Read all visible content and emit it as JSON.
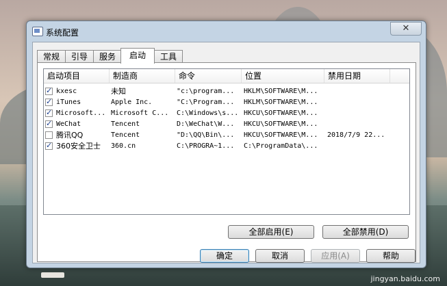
{
  "window": {
    "title": "系统配置",
    "close_glyph": "✕"
  },
  "tabs": [
    {
      "label": "常规"
    },
    {
      "label": "引导"
    },
    {
      "label": "服务"
    },
    {
      "label": "启动"
    },
    {
      "label": "工具"
    }
  ],
  "active_tab": "启动",
  "columns": [
    "启动项目",
    "制造商",
    "命令",
    "位置",
    "禁用日期"
  ],
  "rows": [
    {
      "checked": true,
      "name": "kxesc",
      "maker": "未知",
      "command": "\"c:\\program...",
      "location": "HKLM\\SOFTWARE\\M...",
      "disabled_date": ""
    },
    {
      "checked": true,
      "name": "iTunes",
      "maker": "Apple Inc.",
      "command": "\"C:\\Program...",
      "location": "HKLM\\SOFTWARE\\M...",
      "disabled_date": ""
    },
    {
      "checked": true,
      "name": "Microsoft...",
      "maker": "Microsoft C...",
      "command": "C:\\Windows\\s...",
      "location": "HKCU\\SOFTWARE\\M...",
      "disabled_date": ""
    },
    {
      "checked": true,
      "name": "WeChat",
      "maker": "Tencent",
      "command": "D:\\WeChat\\W...",
      "location": "HKCU\\SOFTWARE\\M...",
      "disabled_date": ""
    },
    {
      "checked": false,
      "name": "腾讯QQ",
      "maker": "Tencent",
      "command": "\"D:\\QQ\\Bin\\...",
      "location": "HKCU\\SOFTWARE\\M...",
      "disabled_date": "2018/7/9 22..."
    },
    {
      "checked": true,
      "name": "360安全卫士",
      "maker": "360.cn",
      "command": "C:\\PROGRA~1...",
      "location": "C:\\ProgramData\\...",
      "disabled_date": ""
    }
  ],
  "buttons": {
    "enable_all": "全部启用(E)",
    "disable_all": "全部禁用(D)",
    "ok": "确定",
    "cancel": "取消",
    "apply": "应用(A)",
    "help": "帮助"
  },
  "watermark": "jingyan.baidu.com"
}
